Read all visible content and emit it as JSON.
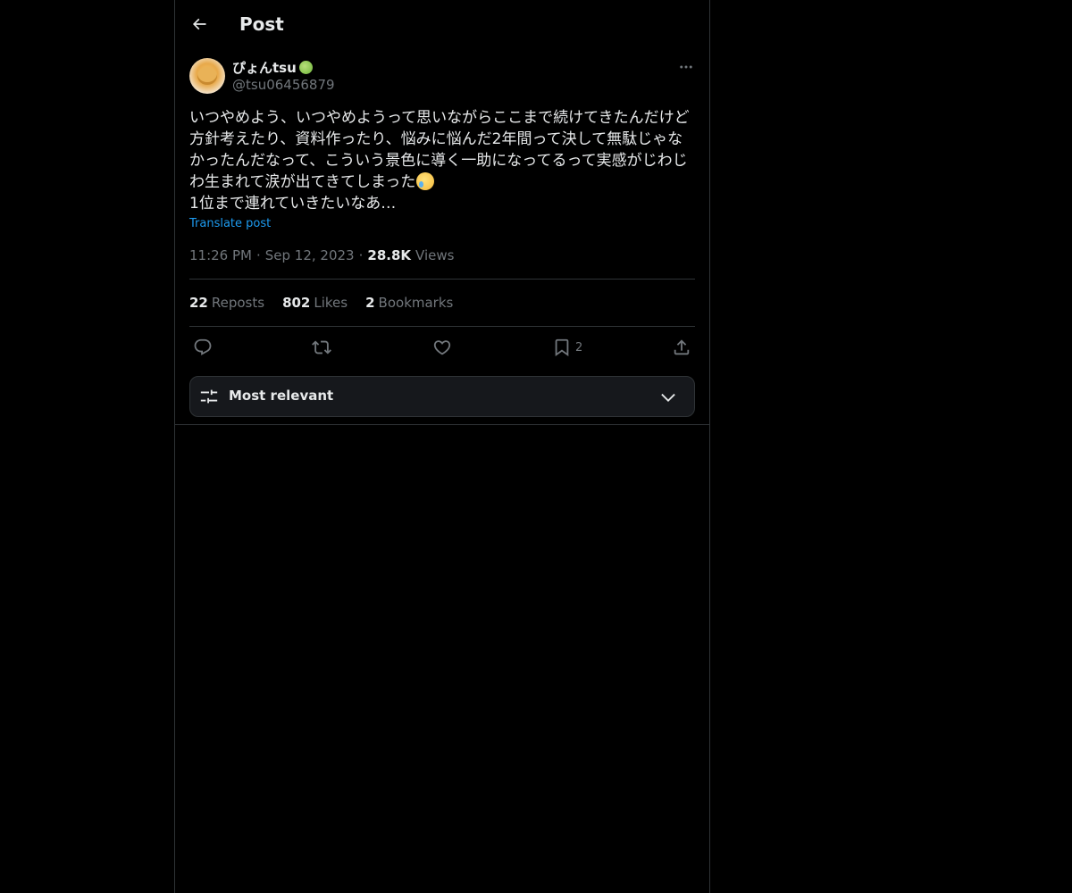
{
  "header": {
    "title": "Post",
    "back_icon": "arrow-left-icon"
  },
  "post": {
    "display_name": "ぴょんtsu",
    "handle": "@tsu06456879",
    "text": "いつやめよう、いつやめようって思いながらここまで続けてきたんだけど方針考えたり、資料作ったり、悩みに悩んだ2年間って決して無駄じゃなかったんだなって、こういう景色に導く一助になってるって実感がじわじわ生まれて涙が出てきてしまった",
    "text_line2": "1位まで連れていきたいなあ…",
    "translate_label": "Translate post",
    "time": "11:26 PM",
    "date": "Sep 12, 2023",
    "views_count": "28.8K",
    "views_label": "Views",
    "separator": "·"
  },
  "stats": {
    "reposts_count": "22",
    "reposts_label": "Reposts",
    "likes_count": "802",
    "likes_label": "Likes",
    "bookmarks_count": "2",
    "bookmarks_label": "Bookmarks"
  },
  "actions": {
    "bookmark_count": "2"
  },
  "sort": {
    "label": "Most relevant"
  },
  "colors": {
    "background": "#000000",
    "text": "#e7e9ea",
    "muted": "#71767b",
    "accent": "#1d9bf0",
    "border": "#2f3336"
  }
}
